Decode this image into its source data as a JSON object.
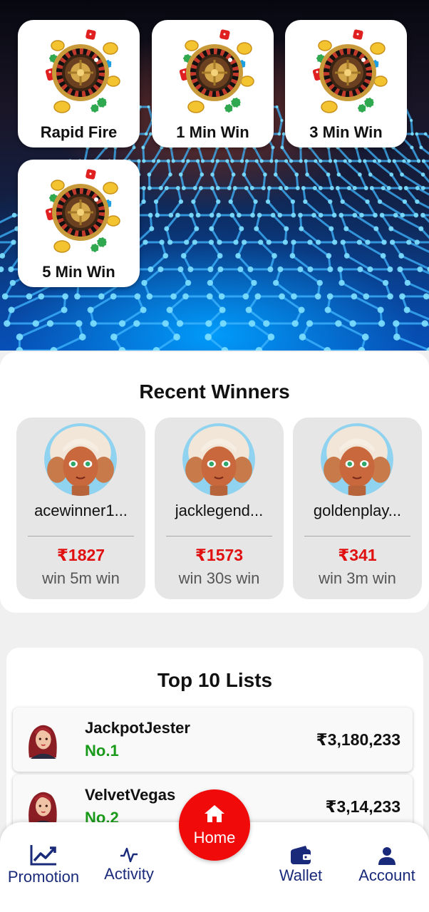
{
  "games": [
    {
      "label": "Rapid Fire",
      "icon": "roulette-icon"
    },
    {
      "label": "1 Min Win",
      "icon": "roulette-icon"
    },
    {
      "label": "3 Min Win",
      "icon": "roulette-icon"
    },
    {
      "label": "5 Min Win",
      "icon": "roulette-icon"
    }
  ],
  "recent_winners": {
    "title": "Recent Winners",
    "items": [
      {
        "name": "acewinner1...",
        "amount": "₹1827",
        "game": "win 5m win"
      },
      {
        "name": "jacklegend...",
        "amount": "₹1573",
        "game": "win 30s win"
      },
      {
        "name": "goldenplay...",
        "amount": "₹341",
        "game": "win 3m win"
      }
    ]
  },
  "top_list": {
    "title": "Top 10 Lists",
    "items": [
      {
        "name": "JackpotJester",
        "rank": "No.1",
        "amount": "₹3,180,233"
      },
      {
        "name": "VelvetVegas",
        "rank": "No.2",
        "amount": "₹3,14,233"
      }
    ]
  },
  "nav": {
    "promotion": "Promotion",
    "activity": "Activity",
    "home": "Home",
    "wallet": "Wallet",
    "account": "Account"
  },
  "colors": {
    "accent_red": "#f00a0a",
    "amount_red": "#e01010",
    "rank_green": "#1a9a1a",
    "nav_blue": "#1a2a7a"
  }
}
